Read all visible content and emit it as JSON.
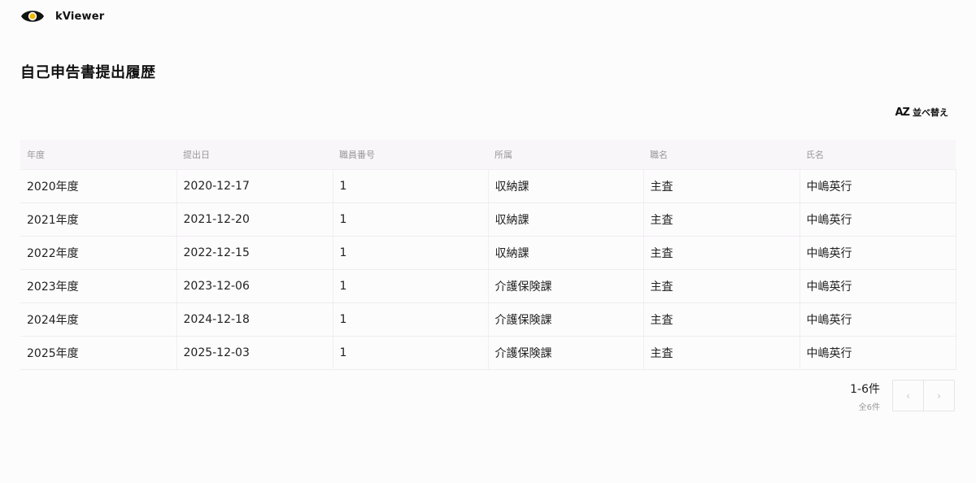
{
  "app": {
    "name": "kViewer",
    "logo_icon": "eye-icon"
  },
  "page": {
    "title": "自己申告書提出履歴"
  },
  "toolbar": {
    "sort_icon_text": "AZ",
    "sort_label": "並べ替え"
  },
  "table": {
    "columns": [
      "年度",
      "提出日",
      "職員番号",
      "所属",
      "職名",
      "氏名"
    ],
    "rows": [
      [
        "2020年度",
        "2020-12-17",
        "1",
        "収納課",
        "主査",
        "中嶋英行"
      ],
      [
        "2021年度",
        "2021-12-20",
        "1",
        "収納課",
        "主査",
        "中嶋英行"
      ],
      [
        "2022年度",
        "2022-12-15",
        "1",
        "収納課",
        "主査",
        "中嶋英行"
      ],
      [
        "2023年度",
        "2023-12-06",
        "1",
        "介護保険課",
        "主査",
        "中嶋英行"
      ],
      [
        "2024年度",
        "2024-12-18",
        "1",
        "介護保険課",
        "主査",
        "中嶋英行"
      ],
      [
        "2025年度",
        "2025-12-03",
        "1",
        "介護保険課",
        "主査",
        "中嶋英行"
      ]
    ]
  },
  "pagination": {
    "range": "1-6件",
    "total": "全6件",
    "prev_icon": "‹",
    "next_icon": "›"
  }
}
